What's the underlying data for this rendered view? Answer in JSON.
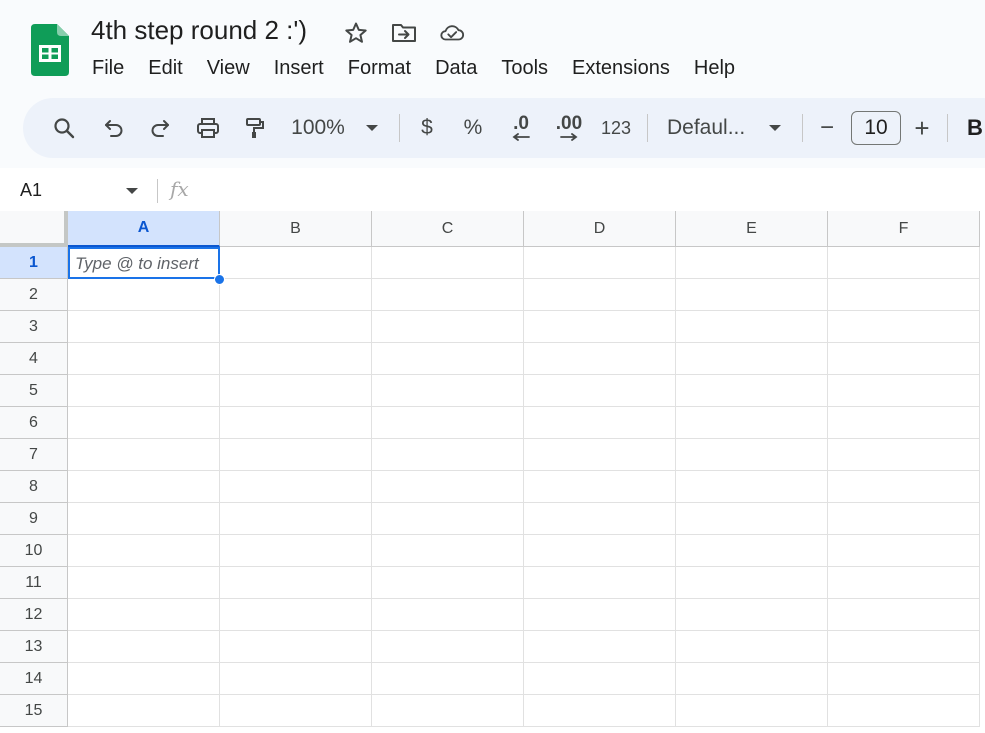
{
  "app": {
    "brand_color": "#0f9d58",
    "accent_color": "#1a73e8"
  },
  "header": {
    "title": "4th step round 2 :')",
    "icons": [
      "star-icon",
      "move-to-folder-icon",
      "cloud-saved-icon"
    ]
  },
  "menu": {
    "items": [
      {
        "label": "File"
      },
      {
        "label": "Edit"
      },
      {
        "label": "View"
      },
      {
        "label": "Insert"
      },
      {
        "label": "Format"
      },
      {
        "label": "Data"
      },
      {
        "label": "Tools"
      },
      {
        "label": "Extensions"
      },
      {
        "label": "Help"
      }
    ]
  },
  "toolbar": {
    "zoom": "100%",
    "currency_label": "$",
    "percent_label": "%",
    "decrease_decimal_label": ".0",
    "increase_decimal_label": ".00",
    "number_format_label": "123",
    "font_family": "Defaul...",
    "font_size": "10",
    "minus_label": "−",
    "plus_label": "+",
    "bold_label": "B"
  },
  "formula_bar": {
    "name_box": "A1",
    "fx_label": "fx"
  },
  "grid": {
    "columns": [
      "A",
      "B",
      "C",
      "D",
      "E",
      "F"
    ],
    "rows": [
      "1",
      "2",
      "3",
      "4",
      "5",
      "6",
      "7",
      "8",
      "9",
      "10",
      "11",
      "12",
      "13",
      "14",
      "15"
    ],
    "selected_column": "A",
    "selected_row": "1",
    "active_cell_placeholder": "Type @ to insert"
  }
}
